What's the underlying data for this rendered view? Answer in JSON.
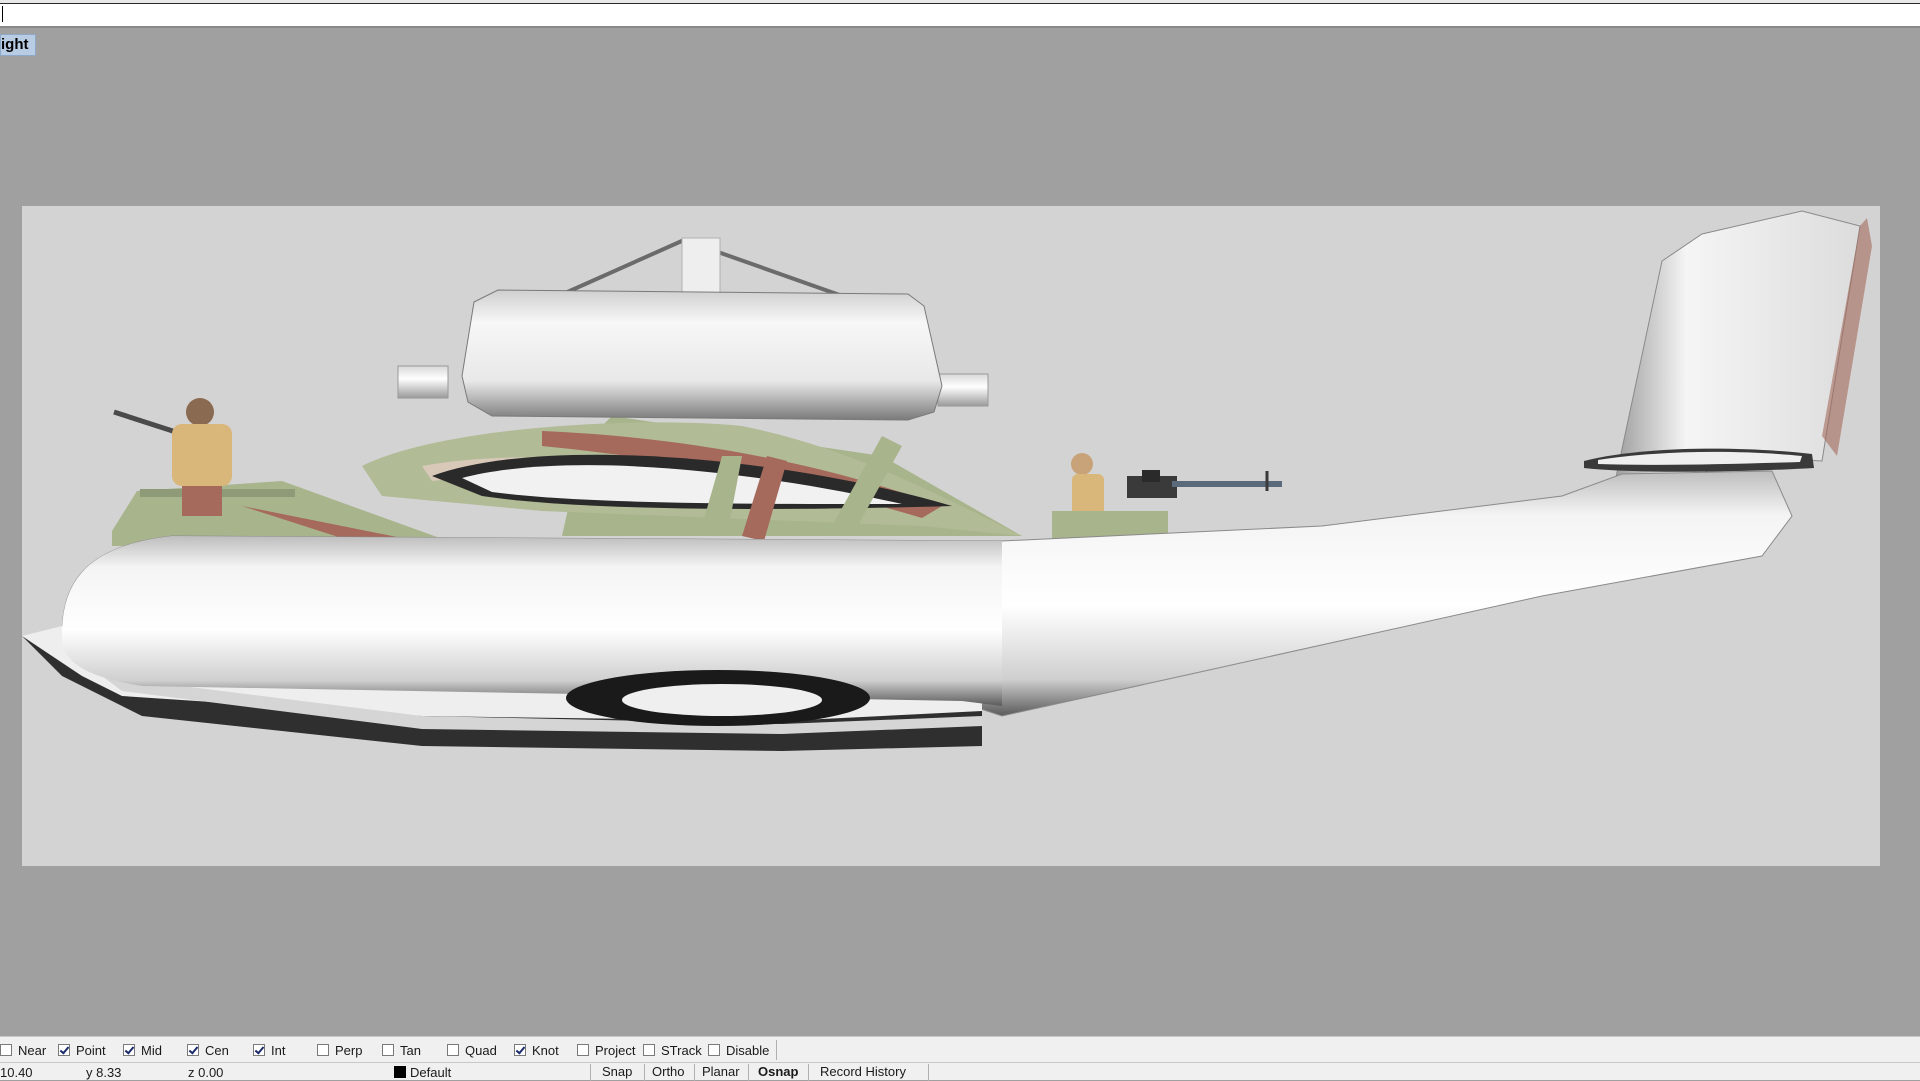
{
  "command": {
    "input_value": ""
  },
  "viewport": {
    "label": "ight"
  },
  "osnap": [
    {
      "label": "Near",
      "checked": false
    },
    {
      "label": "Point",
      "checked": true
    },
    {
      "label": "Mid",
      "checked": true
    },
    {
      "label": "Cen",
      "checked": true
    },
    {
      "label": "Int",
      "checked": true
    },
    {
      "label": "Perp",
      "checked": false
    },
    {
      "label": "Tan",
      "checked": false
    },
    {
      "label": "Quad",
      "checked": false
    },
    {
      "label": "Knot",
      "checked": true
    },
    {
      "label": "Project",
      "checked": false
    },
    {
      "label": "STrack",
      "checked": false
    },
    {
      "label": "Disable",
      "checked": false
    }
  ],
  "status": {
    "x": "10.40",
    "y": "y 8.33",
    "z": "z 0.00",
    "layer": "Default",
    "buttons": {
      "snap": "Snap",
      "ortho": "Ortho",
      "planar": "Planar",
      "osnap": "Osnap",
      "record_history": "Record History"
    }
  },
  "colors": {
    "viewport_bg": "#a0a0a0",
    "backdrop": "#d3d3d3",
    "label_highlight": "#b8cce4",
    "camo_green": "#a8b48c",
    "camo_red": "#a56a5c"
  }
}
